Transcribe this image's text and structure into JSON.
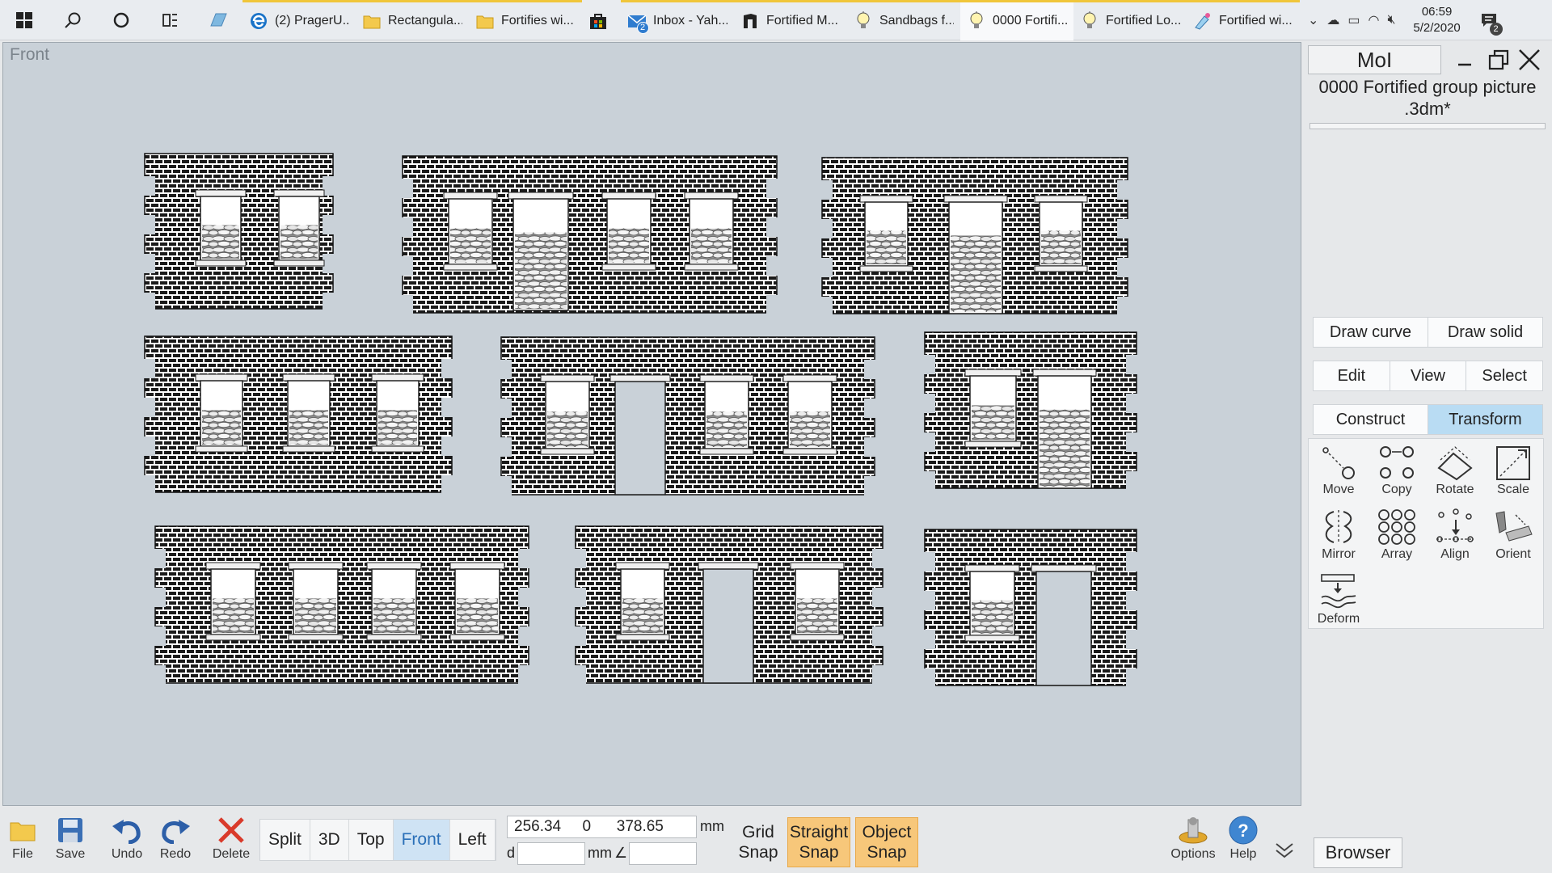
{
  "taskbar": {
    "apps": [
      {
        "label": "(2) PragerU...",
        "icon": "edge-icon"
      },
      {
        "label": "Rectangula...",
        "icon": "folder-icon"
      },
      {
        "label": "Fortifies wi...",
        "icon": "folder-icon"
      },
      {
        "label": "",
        "icon": "store-icon"
      },
      {
        "label": "Inbox - Yah...",
        "icon": "mail-icon",
        "badge": "2"
      },
      {
        "label": "Fortified M...",
        "icon": "app-icon"
      },
      {
        "label": "Sandbags f...",
        "icon": "bulb-icon"
      },
      {
        "label": "0000 Fortifi...",
        "icon": "bulb-icon"
      },
      {
        "label": "Fortified Lo...",
        "icon": "bulb-icon"
      },
      {
        "label": "Fortified wi...",
        "icon": "paint-icon"
      }
    ],
    "time": "06:59",
    "date": "5/2/2020",
    "notification_count": "2"
  },
  "viewport": {
    "label": "Front"
  },
  "panel": {
    "mol": "MoI",
    "doc_title": "0000 Fortified group picture .3dm*",
    "row1": [
      "Draw curve",
      "Draw solid"
    ],
    "row2": [
      "Edit",
      "View",
      "Select"
    ],
    "row3": [
      "Construct",
      "Transform"
    ],
    "tools": [
      "Move",
      "Copy",
      "Rotate",
      "Scale",
      "Mirror",
      "Array",
      "Align",
      "Orient",
      "Deform"
    ]
  },
  "bottom": {
    "file": "File",
    "save": "Save",
    "undo": "Undo",
    "redo": "Redo",
    "delete": "Delete",
    "views": [
      "Split",
      "3D",
      "Top",
      "Front",
      "Left"
    ],
    "coords": "256.34     0      378.65",
    "unit": "mm",
    "d_label": "d",
    "angle_symbol": "∠",
    "grid_snap": "Grid Snap",
    "straight_snap": "Straight Snap",
    "object_snap": "Object Snap",
    "options": "Options",
    "help": "Help",
    "browser": "Browser"
  },
  "colors": {
    "accent": "#f0c63a",
    "selected": "#b9dcf3",
    "snap_on": "#f7c77a",
    "viewport_bg": "#c9d1d8"
  }
}
